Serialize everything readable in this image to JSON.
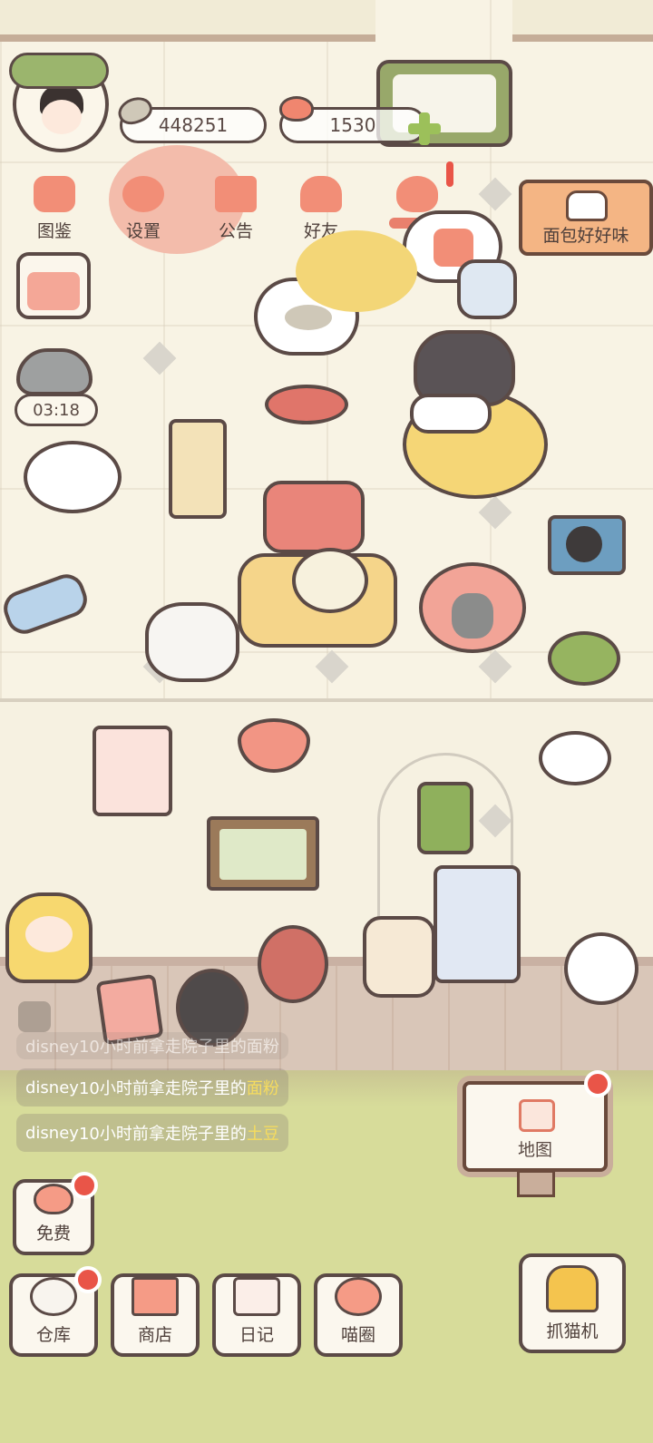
{
  "hud": {
    "fish_coins": "448251",
    "hearts": "1530",
    "timer": "03:18"
  },
  "menu": {
    "items": [
      {
        "label": "图鉴"
      },
      {
        "label": "设置"
      },
      {
        "label": "公告"
      },
      {
        "label": "好友"
      }
    ],
    "event_banner": "面包好好味"
  },
  "feed": {
    "partial": "disney10小时前拿走院子里的面粉",
    "rows": [
      {
        "user": "disney",
        "text": "10小时前拿走院子里的",
        "item": "面粉"
      },
      {
        "user": "disney",
        "text": "10小时前拿走院子里的",
        "item": "土豆"
      }
    ]
  },
  "buttons": {
    "map": "地图",
    "free": "免费",
    "warehouse": "仓库",
    "shop": "商店",
    "diary": "日记",
    "cat_circle": "喵圈",
    "claw_machine": "抓猫机"
  },
  "colors": {
    "accent": "#f28e77",
    "badge": "#e95548",
    "outline": "#5b4a46",
    "highlight": "#f6dc5e"
  }
}
